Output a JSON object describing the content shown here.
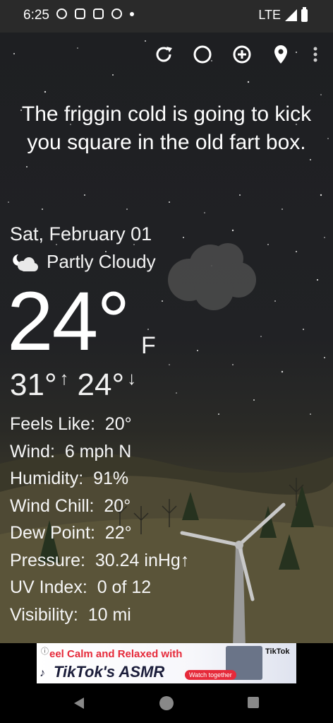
{
  "status_bar": {
    "time": "6:25",
    "network": "LTE"
  },
  "toolbar": {
    "icons": [
      "refresh-icon",
      "theme-icon",
      "add-location-icon",
      "location-pin-icon",
      "overflow-menu-icon"
    ]
  },
  "headline": "The friggin cold is going to kick you square in the old fart box.",
  "weather": {
    "date": "Sat, February 01",
    "condition": "Partly Cloudy",
    "temperature": "24°",
    "unit": "F",
    "high": "31°",
    "low": "24°",
    "details": [
      {
        "label": "Feels Like:",
        "value": "20°"
      },
      {
        "label": "Wind:",
        "value": "6 mph N"
      },
      {
        "label": "Humidity:",
        "value": "91%"
      },
      {
        "label": "Wind Chill:",
        "value": "20°"
      },
      {
        "label": "Dew Point:",
        "value": "22°"
      },
      {
        "label": "Pressure:",
        "value": "30.24 inHg↑"
      },
      {
        "label": "UV Index:",
        "value": "0 of 12"
      },
      {
        "label": "Visibility:",
        "value": "10 mi"
      }
    ]
  },
  "ad": {
    "line1": "eel Calm and Relaxed with",
    "line2": "TikTok's ASMR",
    "brand": "TikTok",
    "cta": "Watch together"
  },
  "colors": {
    "accent_red": "#e62a3a",
    "ad_dark": "#1b1d3a"
  }
}
